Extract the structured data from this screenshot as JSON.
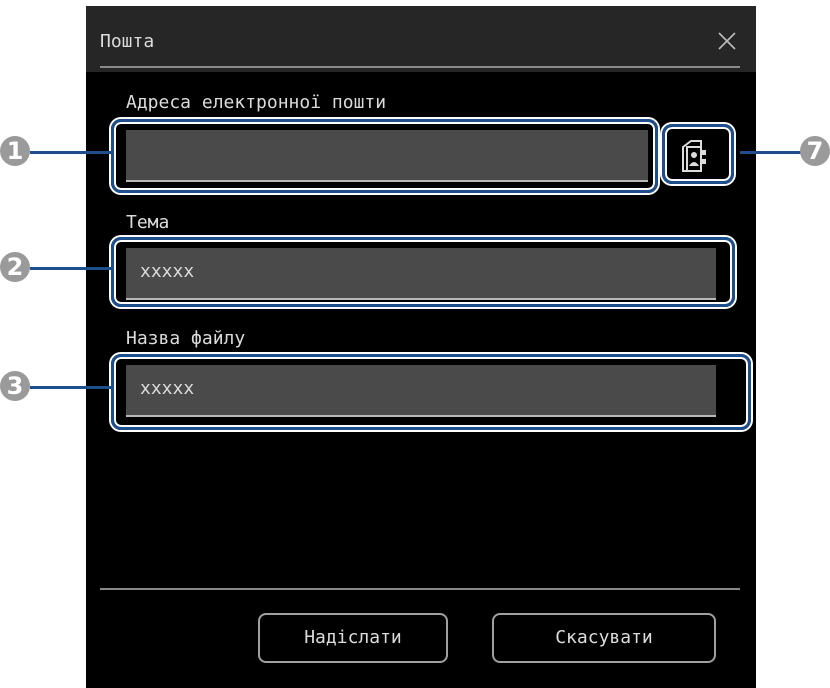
{
  "window": {
    "title": "Пошта",
    "close_icon": "close-icon"
  },
  "fields": {
    "email": {
      "label": "Адреса електронної пошти",
      "value": ""
    },
    "subject": {
      "label": "Тема",
      "value": "xxxxx"
    },
    "filename": {
      "label": "Назва файлу",
      "value": "xxxxx"
    }
  },
  "address_book_icon": "address-book-icon",
  "buttons": {
    "send": "Надіслати",
    "cancel": "Скасувати"
  },
  "callouts": [
    "1",
    "2",
    "3",
    "7"
  ],
  "colors": {
    "dialog_bg": "#000000",
    "titlebar_bg": "#262626",
    "field_bg": "#4a4a4a",
    "callout_blue": "#1f4e8c",
    "marker_gray": "#9a9a9a"
  }
}
